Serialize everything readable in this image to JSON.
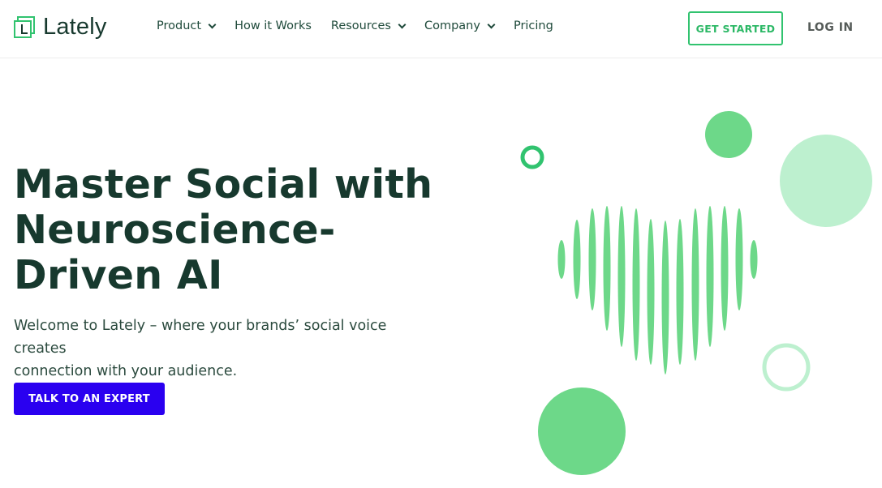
{
  "brand": {
    "name": "Lately"
  },
  "nav": {
    "items": [
      {
        "label": "Product",
        "has_dropdown": true
      },
      {
        "label": "How it Works",
        "has_dropdown": false
      },
      {
        "label": "Resources",
        "has_dropdown": true
      },
      {
        "label": "Company",
        "has_dropdown": true
      },
      {
        "label": "Pricing",
        "has_dropdown": false
      }
    ],
    "get_started_label": "GET STARTED",
    "login_label": "LOG IN"
  },
  "hero": {
    "title_line1": "Master Social with",
    "title_line2": "Neuroscience-",
    "title_line3": "Driven AI",
    "subtitle_line1": "Welcome to Lately – where your brands’ social voice creates",
    "subtitle_line2": "connection with your audience.",
    "cta_label": "TALK TO AN EXPERT"
  },
  "colors": {
    "brand_green": "#31c36f",
    "heading": "#17392e",
    "cta_blue": "#2a00f0",
    "art_green": "#6dd889",
    "art_light_green": "#bdf0cf"
  },
  "icons": {
    "logo": "lately-logo-icon",
    "dropdown": "chevron-down-icon"
  }
}
